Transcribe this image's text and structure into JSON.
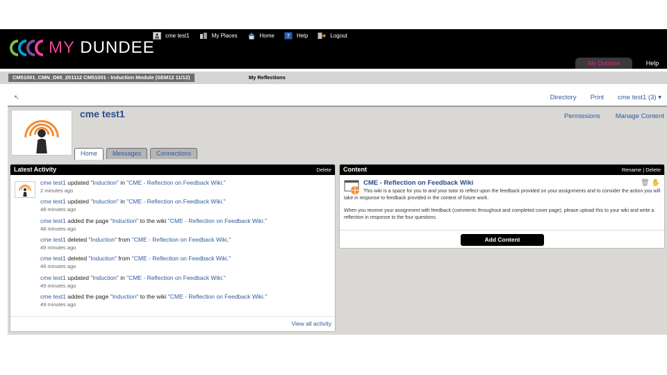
{
  "brand": {
    "my": "MY",
    "name": "DUNDEE"
  },
  "toplinks": [
    {
      "label": "cme test1",
      "icon": "user-icon"
    },
    {
      "label": "My Places",
      "icon": "places-icon"
    },
    {
      "label": "Home",
      "icon": "home-icon"
    },
    {
      "label": "Help",
      "icon": "help-icon"
    },
    {
      "label": "Logout",
      "icon": "logout-icon"
    }
  ],
  "main_tabs": {
    "active": "My Dundee",
    "help": "Help"
  },
  "breadcrumb": {
    "course": "CM51001_CMN_D65_201112 CM51001 - Induction Module (SEM12 11/12)",
    "current": "My Reflections"
  },
  "toolbar": {
    "back": "↖",
    "directory": "Directory",
    "print": "Print",
    "user_menu": "cme test1 (3) ▾"
  },
  "profile": {
    "name": "cme test1",
    "permissions": "Permissions",
    "manage_content": "Manage Content",
    "tabs": [
      "Home",
      "Messages",
      "Connections"
    ]
  },
  "activity": {
    "title": "Latest Activity",
    "delete": "Delete",
    "view_all": "View all activity",
    "items": [
      {
        "who": "cme test1",
        "verb": " updated ",
        "obj": "\"Induction\"",
        "mid": " in ",
        "target": "\"CME - Reflection on Feedback Wiki.\"",
        "time": "2 minutes ago"
      },
      {
        "who": "cme test1",
        "verb": " updated ",
        "obj": "\"Induction\"",
        "mid": " in ",
        "target": "\"CME - Reflection on Feedback Wiki.\"",
        "time": "48 minutes ago"
      },
      {
        "who": "cme test1",
        "verb": " added the page ",
        "obj": "\"Induction\"",
        "mid": " to the wiki ",
        "target": "\"CME - Reflection on Feedback Wiki.\"",
        "time": "48 minutes ago"
      },
      {
        "who": "cme test1",
        "verb": " deleted ",
        "obj": "\"Induction\"",
        "mid": " from ",
        "target": "\"CME - Reflection on Feedback Wiki.\"",
        "time": "49 minutes ago"
      },
      {
        "who": "cme test1",
        "verb": " deleted ",
        "obj": "\"Induction\"",
        "mid": " from ",
        "target": "\"CME - Reflection on Feedback Wiki.\"",
        "time": "49 minutes ago"
      },
      {
        "who": "cme test1",
        "verb": " updated ",
        "obj": "\"Induction\"",
        "mid": " in ",
        "target": "\"CME - Reflection on Feedback Wiki.\"",
        "time": "49 minutes ago"
      },
      {
        "who": "cme test1",
        "verb": " added the page ",
        "obj": "\"Induction\"",
        "mid": " to the wiki ",
        "target": "\"CME - Reflection on Feedback Wiki.\"",
        "time": "49 minutes ago"
      }
    ]
  },
  "content": {
    "title": "Content",
    "actions": "Rename | Delete",
    "wiki_title": "CME - Reflection on Feedback Wiki",
    "desc1": "This wiki is a space for you to and your tutor to reflect upon the feedback provided on your assignments and to consider the action you will take in response to feedback provided in the context of future work.",
    "desc2": "When you receive your assignment with feedback (comments throughout and completed cover page), please upload this to your wiki and write a reflection in response to the four questions.",
    "add_button": "Add Content"
  },
  "colors": {
    "brand_pink": "#e8449a",
    "link": "#2f5c9c",
    "header": "#000000"
  }
}
